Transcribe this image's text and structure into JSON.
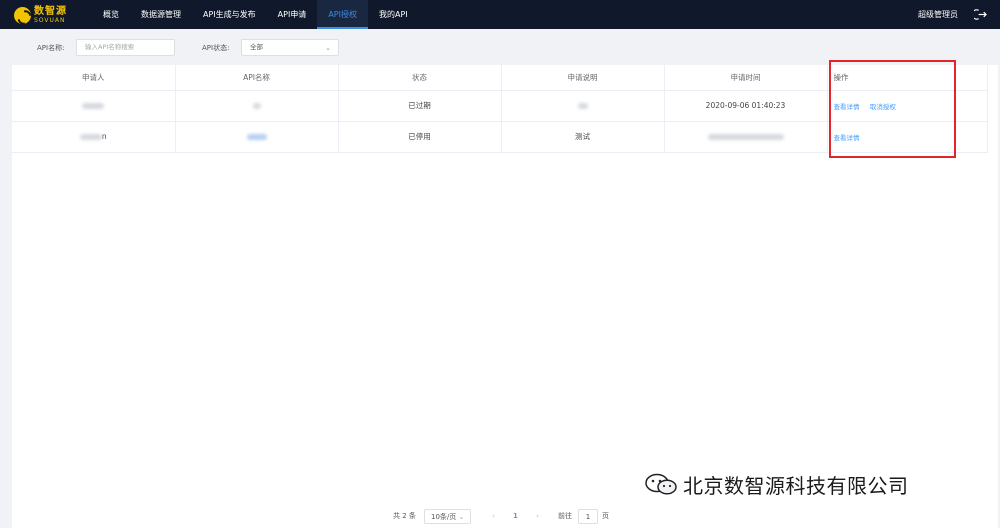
{
  "app": {
    "logo_cn": "数智源",
    "logo_en": "SOVUAN",
    "user": "超级管理员"
  },
  "nav": [
    {
      "label": "概览",
      "active": false
    },
    {
      "label": "数据源管理",
      "active": false
    },
    {
      "label": "API生成与发布",
      "active": false
    },
    {
      "label": "API申请",
      "active": false
    },
    {
      "label": "API授权",
      "active": true
    },
    {
      "label": "我的API",
      "active": false
    }
  ],
  "filters": {
    "name_label": "API名称:",
    "name_placeholder": "输入API名称搜索",
    "status_label": "API状态:",
    "status_value": "全部"
  },
  "table": {
    "columns": [
      "申请人",
      "API名称",
      "状态",
      "申请说明",
      "申请时间",
      "操作"
    ],
    "rows": [
      {
        "applicant": "",
        "api_name": "",
        "status": "已过期",
        "description": "",
        "time": "2020-09-06 01:40:23",
        "actions": [
          "查看详情",
          "取消授权"
        ]
      },
      {
        "applicant": "n",
        "api_name": "",
        "status": "已停用",
        "description": "测试",
        "time": "",
        "actions": [
          "查看详情"
        ]
      }
    ]
  },
  "pagination": {
    "total": "共 2 条",
    "page_size": "10条/页",
    "current": "1",
    "goto_label": "前往",
    "goto_value": "1",
    "page_unit": "页"
  },
  "watermark": "北京数智源科技有限公司",
  "colors": {
    "topbar": "#10192b",
    "accent": "#409eff",
    "highlight": "#e0262b"
  }
}
